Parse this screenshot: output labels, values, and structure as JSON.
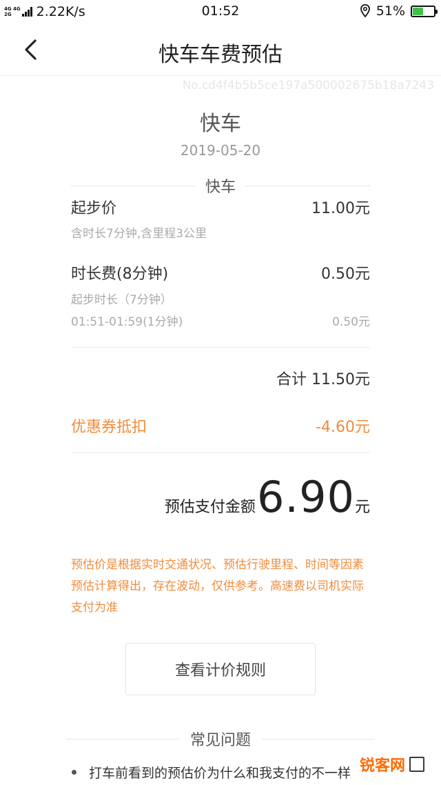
{
  "status_bar": {
    "net_top": "4G 4G",
    "net_bottom": "2G",
    "speed": "2.22K/s",
    "time": "01:52",
    "battery": "51%",
    "battery_level": 0.51
  },
  "nav": {
    "title": "快车车费预估"
  },
  "order_no": "No.cd4f4b5b5ce197a500002675b18a7243",
  "header": {
    "car_type": "快车",
    "date": "2019-05-20"
  },
  "section": {
    "label": "快车"
  },
  "fees": {
    "base": {
      "label": "起步价",
      "amount": "11.00元",
      "desc": "含时长7分钟,含里程3公里"
    },
    "duration": {
      "label": "时长费(8分钟)",
      "amount": "0.50元",
      "desc": "起步时长（7分钟）",
      "detail_label": "01:51-01:59(1分钟)",
      "detail_amount": "0.50元"
    }
  },
  "total": "合计 11.50元",
  "coupon": {
    "label": "优惠券抵扣",
    "amount": "-4.60元"
  },
  "payment": {
    "label": "预估支付金额",
    "amount": "6.90",
    "unit": "元"
  },
  "notice": "预估价是根据实时交通状况、预估行驶里程、时间等因素预估计算得出，存在波动，仅供参考。高速费以司机实际支付为准",
  "rules_button": "查看计价规则",
  "faq": {
    "title": "常见问题",
    "items": [
      "打车前看到的预估价为什么和我支付的不一样"
    ]
  },
  "watermark": "锐客网",
  "colors": {
    "accent": "#f08c3c",
    "battery": "#3ec24a"
  }
}
